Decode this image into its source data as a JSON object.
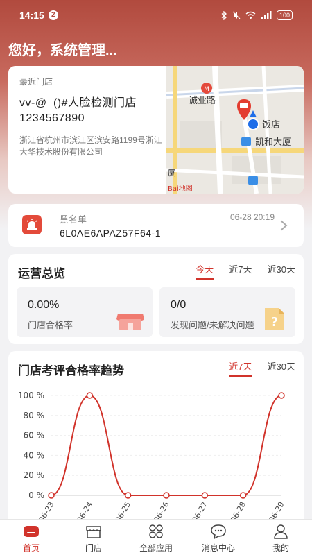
{
  "status": {
    "time": "14:15",
    "notif_count": "2",
    "battery": "100"
  },
  "greeting": "您好，系统管理...",
  "recent_store": {
    "label": "最近门店",
    "name": "vv-@_()#人脸检测门店1234567890",
    "address": "浙江省杭州市滨江区滨安路1199号浙江大华技术股份有限公司",
    "map": {
      "road_label": "诚业路",
      "poi_hotel": "饭店",
      "poi_building": "凯和大厦",
      "poi_partial": "厦",
      "map_logo": "Bai地图"
    }
  },
  "notification": {
    "title": "黑名单",
    "time": "06-28 20:19",
    "code": "6L0AE6APAZ57F64-1"
  },
  "operations": {
    "title": "运营总览",
    "tabs": [
      "今天",
      "近7天",
      "近30天"
    ],
    "active_tab": 0,
    "stats": [
      {
        "value": "0.00%",
        "label": "门店合格率"
      },
      {
        "value": "0/0",
        "label": "发现问题/未解决问题"
      }
    ]
  },
  "trend": {
    "title": "门店考评合格率趋势",
    "tabs": [
      "近7天",
      "近30天"
    ],
    "active_tab": 0
  },
  "chart_data": {
    "type": "line",
    "categories": [
      "06-23",
      "06-24",
      "06-25",
      "06-26",
      "06-27",
      "06-28",
      "06-29"
    ],
    "series": [
      {
        "values": [
          0,
          100,
          0,
          0,
          0,
          0,
          100
        ]
      }
    ],
    "y_ticks": [
      "0 %",
      "20 %",
      "40 %",
      "60 %",
      "80 %",
      "100 %"
    ],
    "ylim": [
      0,
      100
    ],
    "color": "#d1332b",
    "grid": true
  },
  "bottom_nav": [
    {
      "label": "首页",
      "icon": "home-icon"
    },
    {
      "label": "门店",
      "icon": "store-icon"
    },
    {
      "label": "全部应用",
      "icon": "apps-icon"
    },
    {
      "label": "消息中心",
      "icon": "message-icon"
    },
    {
      "label": "我的",
      "icon": "profile-icon"
    }
  ],
  "colors": {
    "accent": "#d1332b",
    "header": "#b14a3e"
  }
}
